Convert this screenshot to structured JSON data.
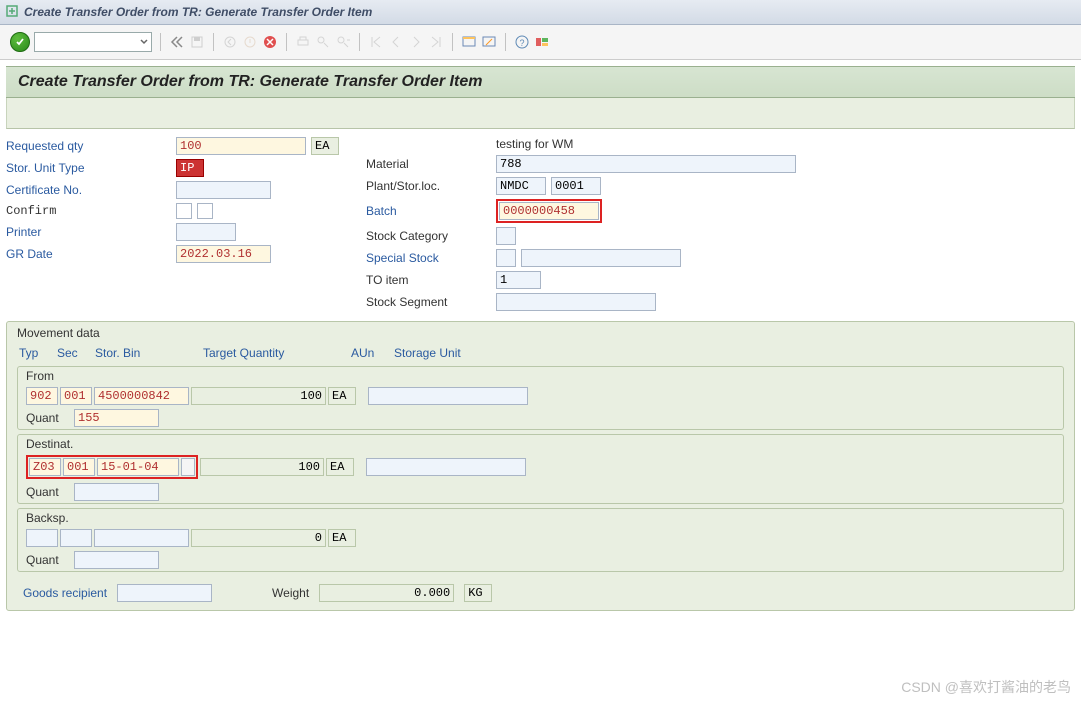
{
  "window": {
    "title": "Create Transfer Order from TR: Generate Transfer Order Item"
  },
  "subheader": {
    "title": "Create Transfer Order from TR: Generate Transfer Order Item"
  },
  "left": {
    "requested_qty_label": "Requested qty",
    "requested_qty_value": "100",
    "requested_qty_uom": "EA",
    "stor_unit_type_label": "Stor. Unit Type",
    "stor_unit_type_value": "IP",
    "certificate_no_label": "Certificate No.",
    "certificate_no_value": "",
    "confirm_label": "Confirm",
    "printer_label": "Printer",
    "printer_value": "",
    "gr_date_label": "GR Date",
    "gr_date_value": "2022.03.16"
  },
  "right": {
    "desc_text": "testing for WM",
    "material_label": "Material",
    "material_value": "788",
    "plant_label": "Plant/Stor.loc.",
    "plant_value": "NMDC",
    "storloc_value": "0001",
    "batch_label": "Batch",
    "batch_value": "0000000458",
    "stock_cat_label": "Stock Category",
    "stock_cat_value": "",
    "special_stock_label": "Special Stock",
    "special_stock_value": "",
    "to_item_label": "TO item",
    "to_item_value": "1",
    "stock_segment_label": "Stock Segment",
    "stock_segment_value": ""
  },
  "movement": {
    "panel_title": "Movement data",
    "col_typ": "Typ",
    "col_sec": "Sec",
    "col_bin": "Stor. Bin",
    "col_qty": "Target Quantity",
    "col_aun": "AUn",
    "col_su": "Storage Unit",
    "quant_label": "Quant",
    "from": {
      "title": "From",
      "typ": "902",
      "sec": "001",
      "bin": "4500000842",
      "qty": "100",
      "aun": "EA",
      "su": "",
      "quant": "155"
    },
    "dest": {
      "title": "Destinat.",
      "typ": "Z03",
      "sec": "001",
      "bin": "15-01-04",
      "qty": "100",
      "aun": "EA",
      "su": "",
      "quant": ""
    },
    "back": {
      "title": "Backsp.",
      "typ": "",
      "sec": "",
      "bin": "",
      "qty": "0",
      "aun": "EA",
      "su": "",
      "quant": ""
    }
  },
  "bottom": {
    "goods_recipient_label": "Goods recipient",
    "goods_recipient_value": "",
    "weight_label": "Weight",
    "weight_value": "0.000",
    "weight_uom": "KG"
  },
  "watermark": "CSDN @喜欢打酱油的老鸟"
}
